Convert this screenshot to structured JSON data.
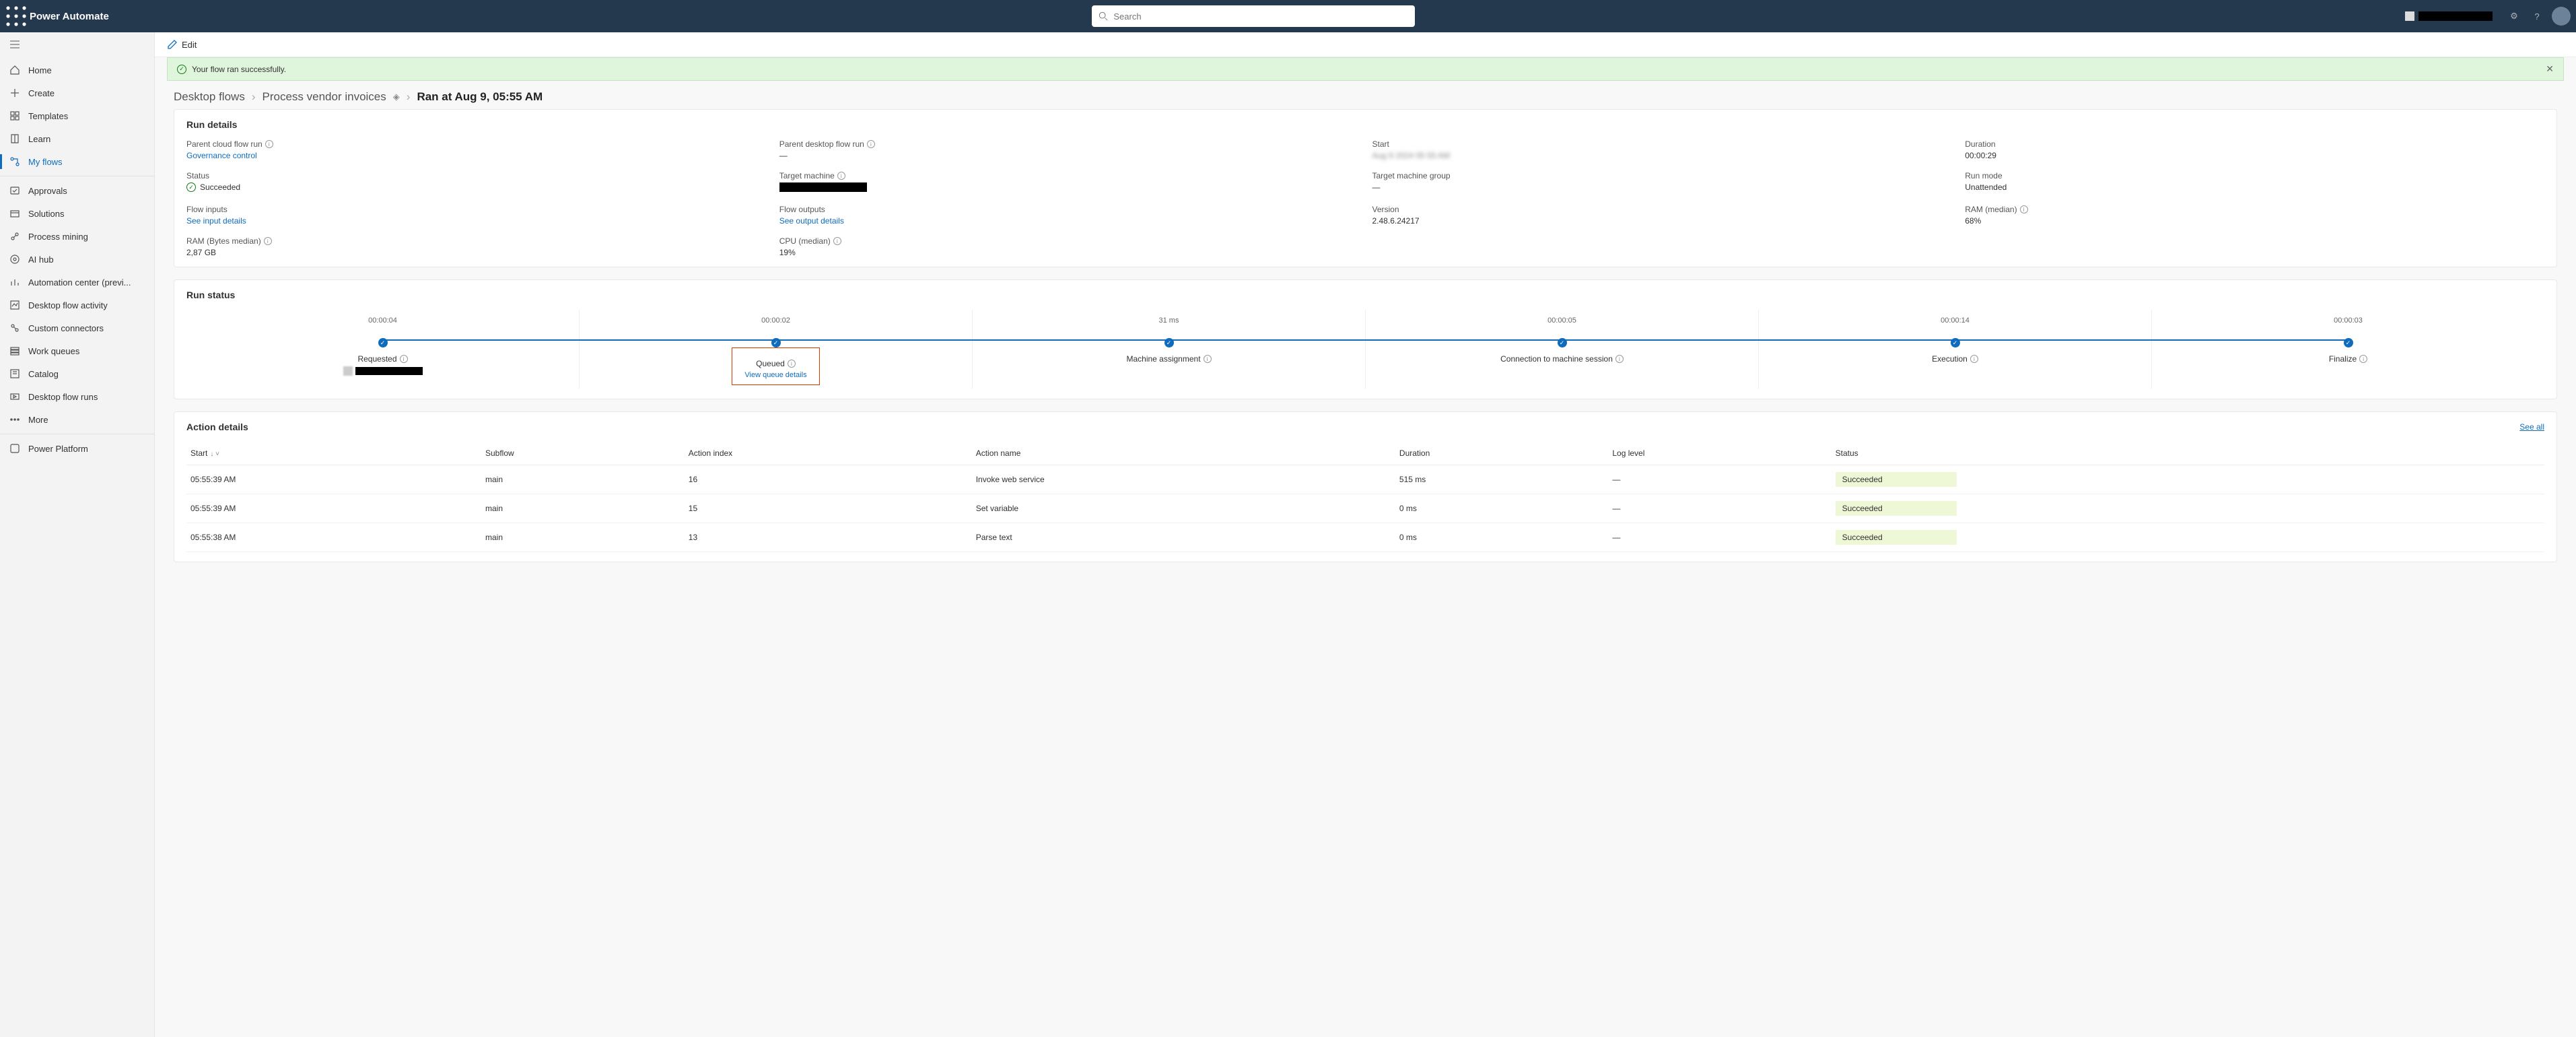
{
  "header": {
    "brand": "Power Automate",
    "search_placeholder": "Search",
    "environment_name": "████████"
  },
  "sidenav": {
    "items": [
      {
        "label": "Home",
        "icon": "home"
      },
      {
        "label": "Create",
        "icon": "plus"
      },
      {
        "label": "Templates",
        "icon": "templates"
      },
      {
        "label": "Learn",
        "icon": "book"
      },
      {
        "label": "My flows",
        "icon": "flow",
        "active": true
      }
    ],
    "items2": [
      {
        "label": "Approvals",
        "icon": "approve"
      },
      {
        "label": "Solutions",
        "icon": "solutions"
      },
      {
        "label": "Process mining",
        "icon": "mining"
      },
      {
        "label": "AI hub",
        "icon": "ai"
      },
      {
        "label": "Automation center (previ...",
        "icon": "chart"
      },
      {
        "label": "Desktop flow activity",
        "icon": "activity"
      },
      {
        "label": "Custom connectors",
        "icon": "connectors"
      },
      {
        "label": "Work queues",
        "icon": "queue"
      },
      {
        "label": "Catalog",
        "icon": "catalog"
      },
      {
        "label": "Desktop flow runs",
        "icon": "runs"
      },
      {
        "label": "More",
        "icon": "more"
      }
    ],
    "footer": {
      "label": "Power Platform",
      "icon": "pp"
    }
  },
  "commandbar": {
    "edit": "Edit"
  },
  "banner": {
    "text": "Your flow ran successfully."
  },
  "breadcrumb": {
    "l1": "Desktop flows",
    "l2": "Process vendor invoices",
    "current": "Ran at Aug 9, 05:55 AM"
  },
  "run_details": {
    "title": "Run details",
    "rows": {
      "parent_cloud_flow_run": {
        "label": "Parent cloud flow run",
        "value": "Governance control",
        "link": true
      },
      "parent_desktop_flow_run": {
        "label": "Parent desktop flow run",
        "value": "—"
      },
      "start": {
        "label": "Start",
        "value": "blurred",
        "blur": true
      },
      "duration": {
        "label": "Duration",
        "value": "00:00:29"
      },
      "status": {
        "label": "Status",
        "value": "Succeeded",
        "icon": "check"
      },
      "target_machine": {
        "label": "Target machine",
        "value": "████████",
        "obf": true
      },
      "target_machine_group": {
        "label": "Target machine group",
        "value": "—"
      },
      "run_mode": {
        "label": "Run mode",
        "value": "Unattended"
      },
      "flow_inputs": {
        "label": "Flow inputs",
        "value": "See input details",
        "link": true
      },
      "flow_outputs": {
        "label": "Flow outputs",
        "value": "See output details",
        "link": true
      },
      "version": {
        "label": "Version",
        "value": "2.48.6.24217"
      },
      "ram_median_pct": {
        "label": "RAM (median)",
        "value": "68%"
      },
      "ram_bytes": {
        "label": "RAM (Bytes median)",
        "value": "2,87 GB"
      },
      "cpu_median": {
        "label": "CPU (median)",
        "value": "19%"
      }
    }
  },
  "run_status": {
    "title": "Run status",
    "stages": [
      {
        "dur": "00:00:04",
        "name": "Requested",
        "sub_user": true
      },
      {
        "dur": "00:00:02",
        "name": "Queued",
        "sub_link": "View queue details",
        "highlight": true
      },
      {
        "dur": "31 ms",
        "name": "Machine assignment"
      },
      {
        "dur": "00:00:05",
        "name": "Connection to machine session"
      },
      {
        "dur": "00:00:14",
        "name": "Execution"
      },
      {
        "dur": "00:00:03",
        "name": "Finalize"
      }
    ]
  },
  "action_details": {
    "title": "Action details",
    "see_all": "See all",
    "columns": [
      "Start",
      "Subflow",
      "Action index",
      "Action name",
      "Duration",
      "Log level",
      "Status"
    ],
    "rows": [
      {
        "start": "05:55:39 AM",
        "subflow": "main",
        "index": "16",
        "action": "Invoke web service",
        "duration": "515 ms",
        "log": "—",
        "status": "Succeeded"
      },
      {
        "start": "05:55:39 AM",
        "subflow": "main",
        "index": "15",
        "action": "Set variable",
        "duration": "0 ms",
        "log": "—",
        "status": "Succeeded"
      },
      {
        "start": "05:55:38 AM",
        "subflow": "main",
        "index": "13",
        "action": "Parse text",
        "duration": "0 ms",
        "log": "—",
        "status": "Succeeded"
      }
    ]
  }
}
